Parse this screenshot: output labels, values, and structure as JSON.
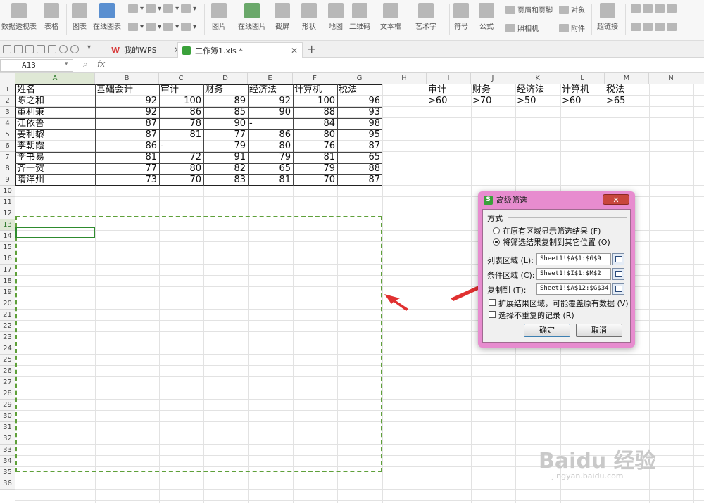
{
  "ribbon": {
    "items": [
      {
        "label": "数据透视表",
        "icon": "pivot-table-icon"
      },
      {
        "label": "表格",
        "icon": "table-icon"
      },
      {
        "label": "图表",
        "icon": "chart-icon"
      },
      {
        "label": "在线图表",
        "icon": "online-chart-icon"
      },
      {
        "label": "图片",
        "icon": "picture-icon"
      },
      {
        "label": "在线图片",
        "icon": "online-picture-icon"
      },
      {
        "label": "截屏",
        "icon": "screenshot-icon"
      },
      {
        "label": "形状",
        "icon": "shape-icon"
      },
      {
        "label": "地图",
        "icon": "map-icon"
      },
      {
        "label": "二维码",
        "icon": "qrcode-icon"
      },
      {
        "label": "文本框",
        "icon": "textbox-icon"
      },
      {
        "label": "艺术字",
        "icon": "wordart-icon"
      },
      {
        "label": "符号",
        "icon": "symbol-icon"
      },
      {
        "label": "公式",
        "icon": "formula-icon"
      },
      {
        "label": "超链接",
        "icon": "hyperlink-icon"
      }
    ],
    "small": {
      "header_footer": "页眉和页脚",
      "object": "对象",
      "camera": "照相机",
      "attachment": "附件"
    }
  },
  "tabs": {
    "mywps": "我的WPS",
    "workbook": "工作簿1.xls *",
    "add": "+"
  },
  "formula": {
    "namebox": "A13",
    "fx": "fx"
  },
  "columns": [
    "A",
    "B",
    "C",
    "D",
    "E",
    "F",
    "G",
    "H",
    "I",
    "J",
    "K",
    "L",
    "M",
    "N"
  ],
  "rows": [
    "1",
    "2",
    "3",
    "4",
    "5",
    "6",
    "7",
    "8",
    "9",
    "10",
    "11",
    "12",
    "13",
    "14",
    "15",
    "16",
    "17",
    "18",
    "19",
    "20",
    "21",
    "22",
    "23",
    "24",
    "25",
    "26",
    "27",
    "28",
    "29",
    "30",
    "31",
    "32",
    "33",
    "34",
    "35",
    "36"
  ],
  "table": {
    "headers": [
      "姓名",
      "基础会计",
      "审计",
      "财务",
      "经济法",
      "计算机",
      "税法"
    ],
    "rows": [
      [
        "陈之和",
        "92",
        "100",
        "89",
        "92",
        "100",
        "96"
      ],
      [
        "董利秉",
        "92",
        "86",
        "85",
        "90",
        "88",
        "93"
      ],
      [
        "江依鲁",
        "87",
        "78",
        "90",
        "-",
        "84",
        "98"
      ],
      [
        "姜利黎",
        "87",
        "81",
        "77",
        "86",
        "80",
        "95"
      ],
      [
        "李朝霞",
        "86",
        "-",
        "79",
        "80",
        "76",
        "87"
      ],
      [
        "李书易",
        "81",
        "72",
        "91",
        "79",
        "81",
        "65"
      ],
      [
        "齐一贺",
        "77",
        "80",
        "82",
        "65",
        "79",
        "88"
      ],
      [
        "隋洋州",
        "73",
        "70",
        "83",
        "81",
        "70",
        "87"
      ]
    ]
  },
  "criteria": {
    "headers": [
      "审计",
      "财务",
      "经济法",
      "计算机",
      "税法"
    ],
    "values": [
      ">60",
      ">70",
      ">50",
      ">60",
      ">65"
    ]
  },
  "dialog": {
    "title": "高级筛选",
    "close": "✕",
    "method_label": "方式",
    "option1": "在原有区域显示筛选结果 (F)",
    "option2": "将筛选结果复制到其它位置 (O)",
    "list_label": "列表区域 (L):",
    "list_value": "Sheet1!$A$1:$G$9",
    "criteria_label": "条件区域 (C):",
    "criteria_value": "Sheet1!$I$1:$M$2",
    "copyto_label": "复制到 (T):",
    "copyto_value": "Sheet1!$A$12:$G$34",
    "expand_label": "扩展结果区域，可能覆盖原有数据 (V)",
    "unique_label": "选择不重复的记录 (R)",
    "ok": "确定",
    "cancel": "取消",
    "selected_option": 2
  },
  "watermark": {
    "brand": "Baidu 经验",
    "url": "jingyan.baidu.com"
  },
  "colors": {
    "selection": "#2e8b2e",
    "dash": "#5fa03a",
    "dialog_frame": "#e78ccf",
    "arrow": "#e03030"
  }
}
